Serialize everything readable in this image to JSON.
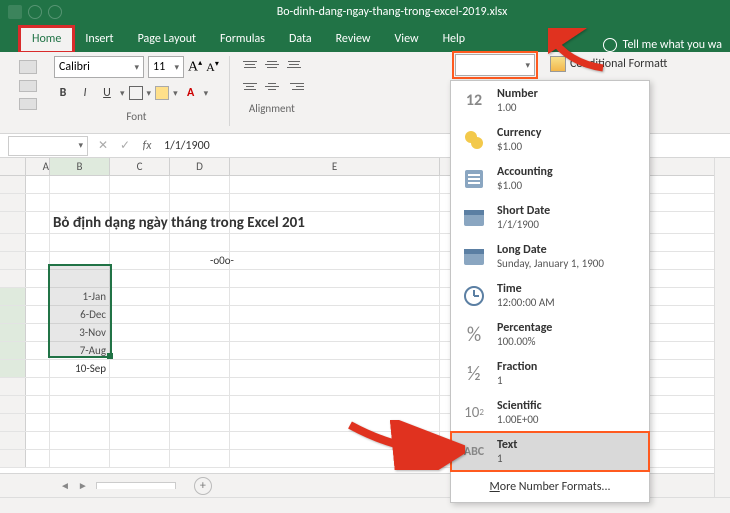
{
  "title": "Bo-dinh-dang-ngay-thang-trong-excel-2019.xlsx",
  "tabs": {
    "home": "Home",
    "insert": "Insert",
    "page_layout": "Page Layout",
    "formulas": "Formulas",
    "data": "Data",
    "review": "Review",
    "view": "View",
    "help": "Help"
  },
  "tell_me": "Tell me what you wa",
  "font": {
    "name": "Calibri",
    "size": "11",
    "bold": "B",
    "italic": "I",
    "underline": "U",
    "group_label": "Font"
  },
  "alignment_label": "Alignment",
  "number_format": {
    "current": "",
    "cond_fmt": "Conditional Formatt"
  },
  "nf_menu": {
    "number": {
      "t": "Number",
      "s": "1.00"
    },
    "currency": {
      "t": "Currency",
      "s": "$1.00"
    },
    "accounting": {
      "t": "Accounting",
      "s": "$1.00"
    },
    "shortdate": {
      "t": "Short Date",
      "s": "1/1/1900"
    },
    "longdate": {
      "t": "Long Date",
      "s": "Sunday, January 1, 1900"
    },
    "time": {
      "t": "Time",
      "s": "12:00:00 AM"
    },
    "percentage": {
      "t": "Percentage",
      "s": "100.00%"
    },
    "fraction": {
      "t": "Fraction",
      "s": "1"
    },
    "scientific": {
      "t": "Scientific",
      "s": "1.00E+00"
    },
    "text": {
      "t": "Text",
      "s": "1"
    },
    "more_prefix": "M",
    "more_rest": "ore Number Formats..."
  },
  "formula_bar": {
    "namebox": "",
    "fx": "fx",
    "value": "1/1/1900"
  },
  "columns": [
    "A",
    "B",
    "C",
    "D",
    "E"
  ],
  "rows_visible": 14,
  "grid": {
    "title_row": "Bỏ định dạng ngày tháng trong Excel 201",
    "ooo": "-o0o-",
    "col_b": [
      "1-Jan",
      "6-Dec",
      "3-Nov",
      "7-Aug",
      "10-Sep"
    ]
  },
  "sheet_tab": "",
  "icons": {
    "number": "12",
    "percent": "%",
    "fraction": "½",
    "scientific": "10²",
    "text": "ABC"
  }
}
